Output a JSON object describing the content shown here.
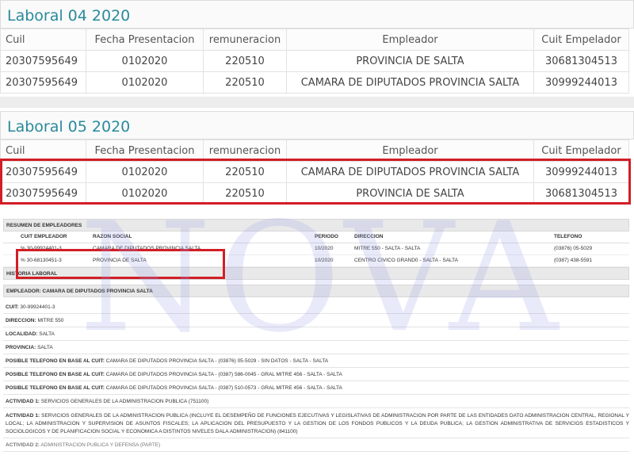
{
  "section1": {
    "title": "Laboral 04 2020",
    "headers": [
      "Cuil",
      "Fecha Presentacion",
      "remuneracion",
      "Empleador",
      "Cuit Empelador"
    ],
    "rows": [
      [
        "20307595649",
        "0102020",
        "220510",
        "PROVINCIA DE SALTA",
        "30681304513"
      ],
      [
        "20307595649",
        "0102020",
        "220510",
        "CAMARA DE DIPUTADOS PROVINCIA SALTA",
        "30999244013"
      ]
    ]
  },
  "section2": {
    "title": "Laboral 05 2020",
    "headers": [
      "Cuil",
      "Fecha Presentacion",
      "remuneracion",
      "Empleador",
      "Cuit Empelador"
    ],
    "rows": [
      [
        "20307595649",
        "0102020",
        "220510",
        "CAMARA DE DIPUTADOS PROVINCIA SALTA",
        "30999244013"
      ],
      [
        "20307595649",
        "0102020",
        "220510",
        "PROVINCIA DE SALTA",
        "30681304513"
      ]
    ]
  },
  "resumen": {
    "title": "RESUMEN DE EMPLEADORES",
    "headers": [
      "CUIT EMPLEADOR",
      "RAZON SOCIAL",
      "PERIODO",
      "DIRECCION",
      "TELEFONO"
    ],
    "rows": [
      [
        "30-99924401-3",
        "CAMARA DE DIPUTADOS PROVINCIA SALTA",
        "10/2020",
        "MITRE 550 - SALTA - SALTA",
        "(03876) 05-5029"
      ],
      [
        "30-68130451-3",
        "PROVINCIA DE SALTA",
        "10/2020",
        "CENTRO CIVICO GRAND0 - SALTA - SALTA",
        "(0387) 438-5591"
      ]
    ]
  },
  "historia": {
    "title": "HISTORIA LABORAL",
    "empleador": "EMPLEADOR: CAMARA DE DIPUTADOS PROVINCIA SALTA",
    "lines": [
      [
        "CUIT:",
        " 30-99924401-3"
      ],
      [
        "DIRECCION:",
        " MITRE 550"
      ],
      [
        "LOCALIDAD:",
        " SALTA"
      ],
      [
        "PROVINCIA:",
        " SALTA"
      ],
      [
        "POSIBLE TELEFONO EN BASE AL CUIT:",
        " CAMARA DE DIPUTADOS PROVINCIA SALTA - (03876) 05-5029 - SIN DATOS - SALTA - SALTA"
      ],
      [
        "POSIBLE TELEFONO EN BASE AL CUIT:",
        " CAMARA DE DIPUTADOS PROVINCIA SALTA - (0387) 586-0045 - GRAL MITRE 456 - SALTA - SALTA"
      ],
      [
        "POSIBLE TELEFONO EN BASE AL CUIT:",
        " CAMARA DE DIPUTADOS PROVINCIA SALTA - (0387) 510-0573 - GRAL MITRE 456 - SALTA - SALTA"
      ],
      [
        "ACTIVIDAD 1:",
        " SERVICIOS GENERALES DE LA ADMINISTRACION PUBLICA (751100)"
      ]
    ],
    "act_long_label": "ACTIVIDAD 1:",
    "act_long": " SERVICIOS GENERALES DE LA ADMINISTRACION PUBLICA (INCLUYE EL DESEMPEÑO DE FUNCIONES EJECUTIVAS Y LEGISLATIVAS DE ADMINISTRACION POR PARTE DE LAS ENTIDADES DATO ADMINISTRACION CENTRAL, REGIONAL Y LOCAL; LA ADMINISTRACION Y SUPERVISION DE ASUNTOS FISCALES; LA APLICACION DEL PRESUPUESTO Y LA GESTION DE LOS FONDOS PUBLICOS Y LA DEUDA PUBLICA; LA GESTION ADMINISTRATIVA DE SERVICIOS ESTADISTICOS Y SOCIOLOGICOS Y DE PLANIFICACION SOCIAL Y ECONOMICA A DISTINTOS NIVELES DALA ADMINISTRACION) (841100)",
    "act2_label": "ACTIVIDAD 2:",
    "act2": " ADMINISTRACION PUBLICA Y DEFENSA (PARTE)"
  },
  "watermark": "NOVA",
  "colors": {
    "title": "#2a8a9c",
    "highlight": "#d21e26"
  }
}
